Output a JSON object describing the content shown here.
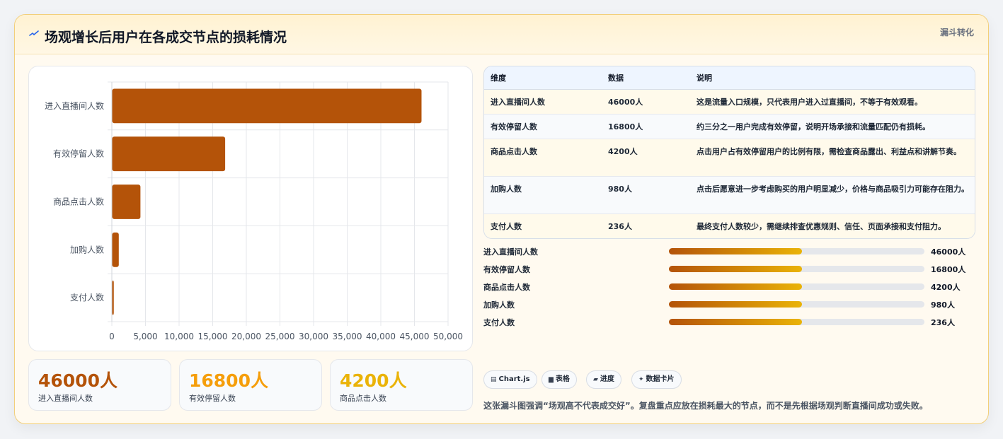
{
  "header": {
    "title": "场观增长后用户在各成交节点的损耗情况",
    "tag": "漏斗转化"
  },
  "colors": {
    "bar": "#b45309",
    "stat1": "#b45309",
    "stat2": "#f59e0b",
    "stat3": "#eab308"
  },
  "chart_data": {
    "type": "bar",
    "orientation": "horizontal",
    "categories": [
      "进入直播间人数",
      "有效停留人数",
      "商品点击人数",
      "加购人数",
      "支付人数"
    ],
    "values": [
      46000,
      16800,
      4200,
      980,
      236
    ],
    "xlim": [
      0,
      50000
    ],
    "xticks": [
      0,
      5000,
      10000,
      15000,
      20000,
      25000,
      30000,
      35000,
      40000,
      45000,
      50000
    ],
    "xtick_labels": [
      "0",
      "5,000",
      "10,000",
      "15,000",
      "20,000",
      "25,000",
      "30,000",
      "35,000",
      "40,000",
      "45,000",
      "50,000"
    ],
    "grid": true,
    "legend": false
  },
  "stats": [
    {
      "value": "46000人",
      "label": "进入直播间人数"
    },
    {
      "value": "16800人",
      "label": "有效停留人数"
    },
    {
      "value": "4200人",
      "label": "商品点击人数"
    }
  ],
  "table": {
    "headers": [
      "维度",
      "数据",
      "说明"
    ],
    "rows": [
      {
        "dim": "进入直播间人数",
        "data": "46000人",
        "desc": "这是流量入口规模，只代表用户进入过直播间，不等于有效观看。"
      },
      {
        "dim": "有效停留人数",
        "data": "16800人",
        "desc": "约三分之一用户完成有效停留，说明开场承接和流量匹配仍有损耗。"
      },
      {
        "dim": "商品点击人数",
        "data": "4200人",
        "desc": "点击用户占有效停留用户的比例有限，需检查商品露出、利益点和讲解节奏。"
      },
      {
        "dim": "加购人数",
        "data": "980人",
        "desc": "点击后愿意进一步考虑购买的用户明显减少，价格与商品吸引力可能存在阻力。"
      },
      {
        "dim": "支付人数",
        "data": "236人",
        "desc": "最终支付人数较少，需继续排查优惠规则、信任、页面承接和支付阻力。"
      }
    ]
  },
  "progress": [
    {
      "label": "进入直播间人数",
      "value": "46000人",
      "fill": 0.52
    },
    {
      "label": "有效停留人数",
      "value": "16800人",
      "fill": 0.52
    },
    {
      "label": "商品点击人数",
      "value": "4200人",
      "fill": 0.52
    },
    {
      "label": "加购人数",
      "value": "980人",
      "fill": 0.52
    },
    {
      "label": "支付人数",
      "value": "236人",
      "fill": 0.52
    }
  ],
  "chips": [
    {
      "icon": "▤",
      "label": "Chart.js"
    },
    {
      "icon": "▆",
      "label": "表格"
    },
    {
      "icon": "▰",
      "label": "进度"
    },
    {
      "icon": "✦",
      "label": "数据卡片"
    }
  ],
  "summary": "这张漏斗图强调“场观高不代表成交好”。复盘重点应放在损耗最大的节点，而不是先根据场观判断直播间成功或失败。"
}
